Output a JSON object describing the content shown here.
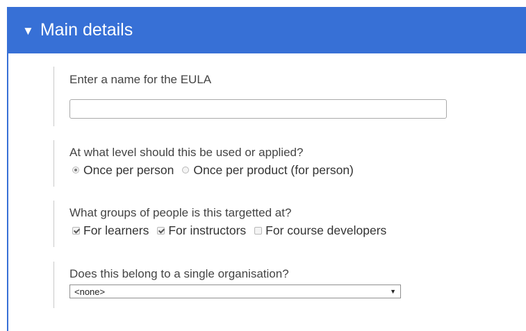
{
  "panel": {
    "title": "Main details",
    "caret": "▼"
  },
  "fields": {
    "name": {
      "label": "Enter a name for the EULA",
      "value": ""
    },
    "level": {
      "label": "At what level should this be used or applied?",
      "options": [
        {
          "label": "Once per person",
          "checked": true
        },
        {
          "label": "Once per product (for person)",
          "checked": false
        }
      ]
    },
    "groups": {
      "label": "What groups of people is this targetted at?",
      "options": [
        {
          "label": "For learners",
          "checked": true
        },
        {
          "label": "For instructors",
          "checked": true
        },
        {
          "label": "For course developers",
          "checked": false
        }
      ]
    },
    "organisation": {
      "label": "Does this belong to a single organisation?",
      "selected": "<none>",
      "arrow": "▼"
    }
  }
}
